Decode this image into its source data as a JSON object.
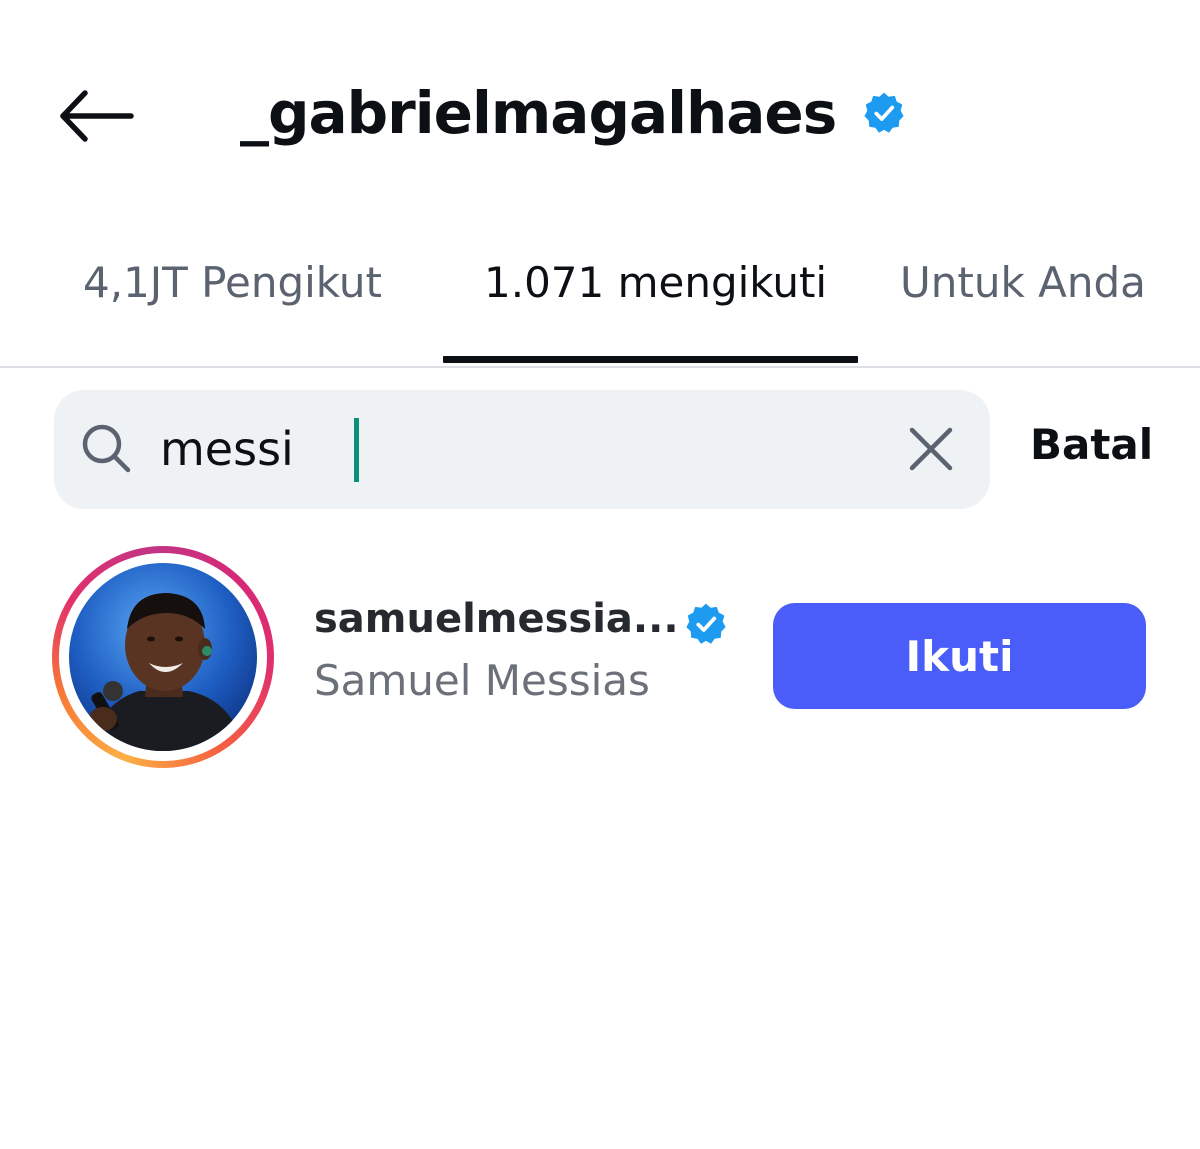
{
  "header": {
    "back_icon": "arrow-left-icon",
    "title": "_gabrielmagalhaes",
    "verified_icon": "verified-badge-icon",
    "verified_color": "#1d9bf0"
  },
  "tabs": [
    {
      "label": "4,1JT Pengikut",
      "active": false
    },
    {
      "label": "1.071 mengikuti",
      "active": true
    },
    {
      "label": "Untuk Anda",
      "active": false
    }
  ],
  "search": {
    "icon": "search-icon",
    "value": "messi",
    "clear_icon": "close-icon",
    "cancel_label": "Batal"
  },
  "results": [
    {
      "username": "samuelmessia...",
      "full_name": "Samuel Messias",
      "verified": true,
      "has_story_ring": true,
      "follow_label": "Ikuti",
      "follow_color": "#4a5df9"
    }
  ],
  "colors": {
    "text_primary": "#0c1014",
    "text_secondary": "#6b7079",
    "search_bg": "#eff2f5",
    "caret": "#0a8f7a"
  }
}
